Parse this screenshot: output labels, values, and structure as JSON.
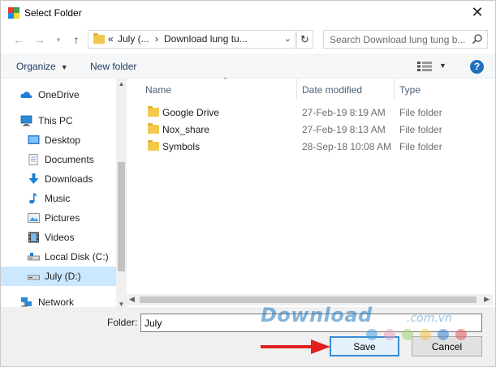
{
  "window": {
    "title": "Select Folder"
  },
  "address": {
    "prefix": "«",
    "crumb1": "July (...",
    "crumb_sep": "›",
    "crumb2": "Download lung tu...",
    "search_placeholder": "Search Download lung tung b..."
  },
  "toolbar": {
    "organize": "Organize",
    "new_folder": "New folder"
  },
  "nav": [
    {
      "label": "OneDrive",
      "icon": "cloud-icon"
    },
    {
      "label": "This PC",
      "icon": "computer-icon"
    },
    {
      "label": "Desktop",
      "icon": "desktop-icon"
    },
    {
      "label": "Documents",
      "icon": "documents-icon"
    },
    {
      "label": "Downloads",
      "icon": "download-arrow-icon"
    },
    {
      "label": "Music",
      "icon": "music-note-icon"
    },
    {
      "label": "Pictures",
      "icon": "pictures-icon"
    },
    {
      "label": "Videos",
      "icon": "film-icon"
    },
    {
      "label": "Local Disk (C:)",
      "icon": "drive-icon"
    },
    {
      "label": "July (D:)",
      "icon": "drive-icon",
      "selected": true
    },
    {
      "label": "Network",
      "icon": "network-icon"
    }
  ],
  "columns": {
    "name": "Name",
    "date": "Date modified",
    "type": "Type"
  },
  "files": [
    {
      "name": "Google Drive",
      "date": "27-Feb-19 8:19 AM",
      "type": "File folder"
    },
    {
      "name": "Nox_share",
      "date": "27-Feb-19 8:13 AM",
      "type": "File folder"
    },
    {
      "name": "Symbols",
      "date": "28-Sep-18 10:08 AM",
      "type": "File folder"
    }
  ],
  "bottom": {
    "folder_label": "Folder:",
    "folder_value": "July",
    "save": "Save",
    "cancel": "Cancel"
  },
  "watermark": {
    "text": "Download",
    "suffix": ".com.vn"
  },
  "colors": {
    "selection": "#cce8ff",
    "accent": "#1f6fbf",
    "arrow": "#e0201e"
  }
}
